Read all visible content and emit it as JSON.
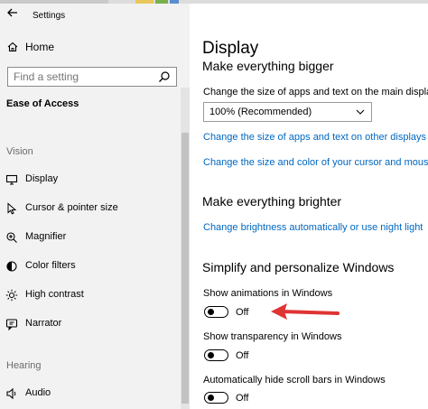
{
  "window": {
    "title": "Settings"
  },
  "sidebar": {
    "home_label": "Home",
    "search_placeholder": "Find a setting",
    "section_title": "Ease of Access",
    "groups": {
      "vision": "Vision",
      "hearing": "Hearing"
    },
    "items": [
      {
        "label": "Display",
        "icon": "monitor-icon"
      },
      {
        "label": "Cursor & pointer size",
        "icon": "cursor-icon"
      },
      {
        "label": "Magnifier",
        "icon": "magnifier-icon"
      },
      {
        "label": "Color filters",
        "icon": "color-filter-icon"
      },
      {
        "label": "High contrast",
        "icon": "sun-icon"
      },
      {
        "label": "Narrator",
        "icon": "narrator-icon"
      },
      {
        "label": "Audio",
        "icon": "speaker-icon"
      }
    ]
  },
  "main": {
    "page_title": "Display",
    "bigger": {
      "heading": "Make everything bigger",
      "scale_label": "Change the size of apps and text on the main display",
      "scale_value": "100% (Recommended)",
      "link_other_displays": "Change the size of apps and text on other displays",
      "link_cursor": "Change the size and color of your cursor and mouse"
    },
    "brighter": {
      "heading": "Make everything brighter",
      "link_brightness": "Change brightness automatically or use night light"
    },
    "simplify": {
      "heading": "Simplify and personalize Windows",
      "toggles": [
        {
          "label": "Show animations in Windows",
          "state": "Off"
        },
        {
          "label": "Show transparency in Windows",
          "state": "Off"
        },
        {
          "label": "Automatically hide scroll bars in Windows",
          "state": "Off"
        }
      ]
    }
  },
  "colors": {
    "link": "#0067c0",
    "sidebar_bg": "#f2f2f2",
    "annotation_arrow": "#e03434"
  }
}
